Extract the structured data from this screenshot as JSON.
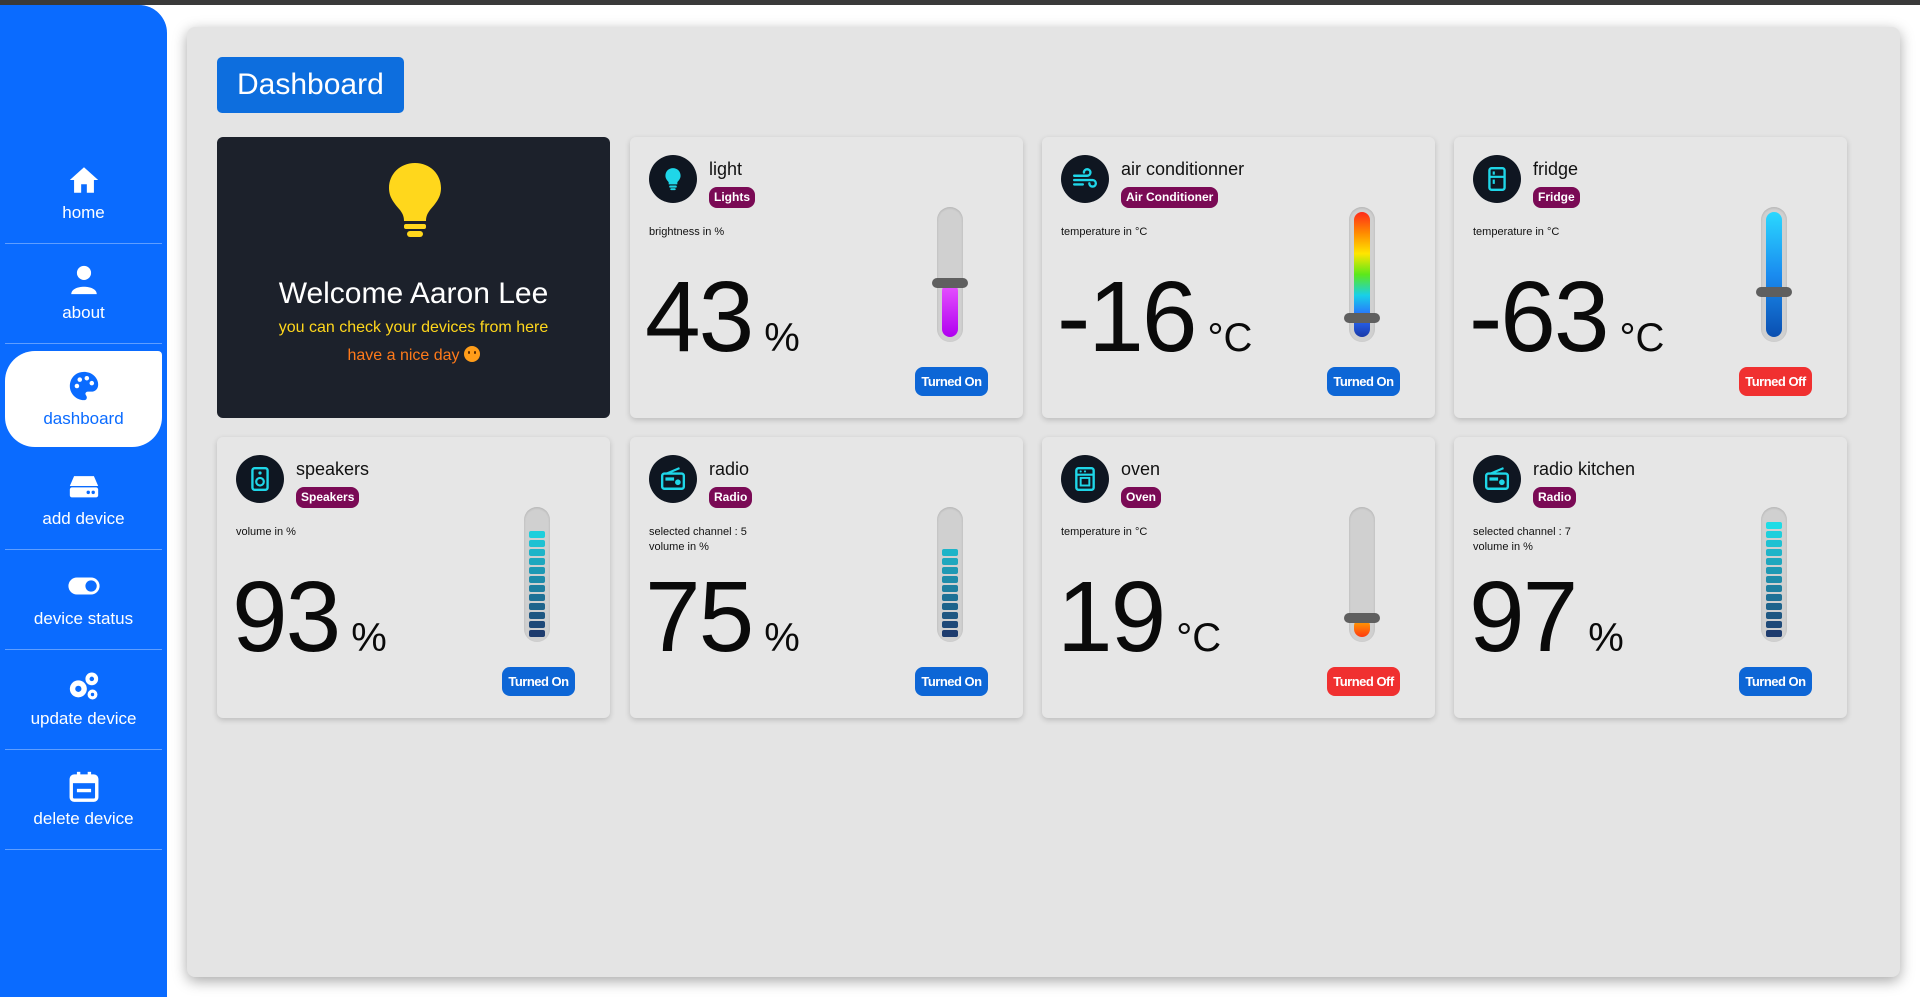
{
  "sidebar": {
    "items": [
      {
        "label": "home",
        "icon": "home-icon"
      },
      {
        "label": "about",
        "icon": "user-icon"
      },
      {
        "label": "dashboard",
        "icon": "palette-icon",
        "active": true
      },
      {
        "label": "add device",
        "icon": "drive-icon"
      },
      {
        "label": "device status",
        "icon": "toggle-icon"
      },
      {
        "label": "update device",
        "icon": "gears-icon"
      },
      {
        "label": "delete device",
        "icon": "calendar-icon"
      }
    ]
  },
  "main": {
    "title": "Dashboard",
    "welcome": {
      "title": "Welcome Aaron Lee",
      "subtitle": "you can check your devices from here",
      "subtitle2": "have a nice day"
    },
    "devices": [
      {
        "name": "light",
        "tag": "Lights",
        "note": "brightness in %",
        "note2": "",
        "value": "43",
        "unit": "%",
        "status": "Turned On",
        "level": 0.43,
        "icon": "lightbulb-icon"
      },
      {
        "name": "air conditionner",
        "tag": "Air Conditioner",
        "note": "temperature in °C",
        "note2": "",
        "value": "-16",
        "unit": "°C",
        "status": "Turned On",
        "level": 0.15,
        "icon": "wind-icon"
      },
      {
        "name": "fridge",
        "tag": "Fridge",
        "note": "temperature in °C",
        "note2": "",
        "value": "-63",
        "unit": "°C",
        "status": "Turned Off",
        "level": 0.36,
        "icon": "fridge-icon"
      },
      {
        "name": "speakers",
        "tag": "Speakers",
        "note": "volume in %",
        "note2": "",
        "value": "93",
        "unit": "%",
        "status": "Turned On",
        "level": 0.93,
        "icon": "speaker-icon"
      },
      {
        "name": "radio",
        "tag": "Radio",
        "note": "selected channel : 5",
        "note2": "volume in %",
        "value": "75",
        "unit": "%",
        "status": "Turned On",
        "level": 0.75,
        "icon": "radio-icon"
      },
      {
        "name": "oven",
        "tag": "Oven",
        "note": "temperature in °C",
        "note2": "",
        "value": "19",
        "unit": "°C",
        "status": "Turned Off",
        "level": 0.15,
        "icon": "oven-icon"
      },
      {
        "name": "radio kitchen",
        "tag": "Radio",
        "note": "selected channel : 7",
        "note2": "volume in %",
        "value": "97",
        "unit": "%",
        "status": "Turned On",
        "level": 0.97,
        "icon": "radio-icon"
      }
    ]
  },
  "colors": {
    "sidebar": "#0a6bff",
    "primary_button": "#0d66d6",
    "off_button": "#f03030",
    "tag": "#7a0a55",
    "icon_accent": "#1fd6e8",
    "welcome_bg": "#1c212b"
  }
}
